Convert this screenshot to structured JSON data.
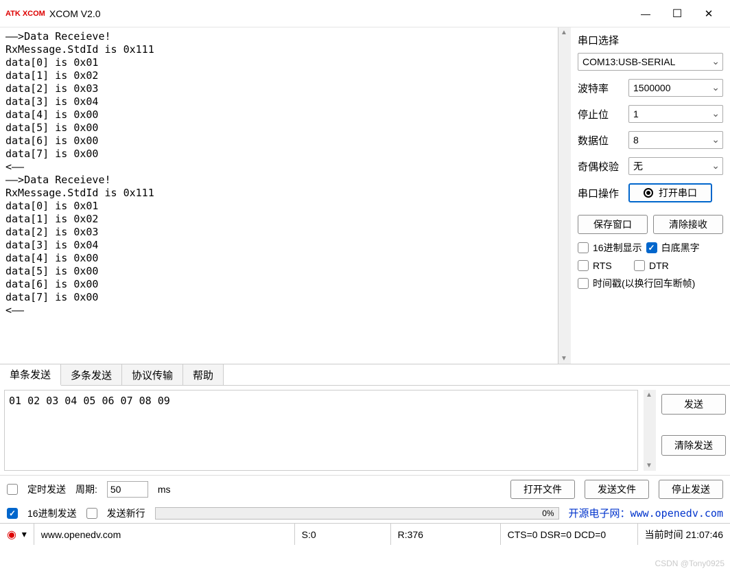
{
  "title": "XCOM V2.0",
  "logo_text": "ATK\nXCOM",
  "rx_log": "——>Data Receieve!\nRxMessage.StdId is 0x111\ndata[0] is 0x01\ndata[1] is 0x02\ndata[2] is 0x03\ndata[3] is 0x04\ndata[4] is 0x00\ndata[5] is 0x00\ndata[6] is 0x00\ndata[7] is 0x00\n<——\n——>Data Receieve!\nRxMessage.StdId is 0x111\ndata[0] is 0x01\ndata[1] is 0x02\ndata[2] is 0x03\ndata[3] is 0x04\ndata[4] is 0x00\ndata[5] is 0x00\ndata[6] is 0x00\ndata[7] is 0x00\n<——",
  "side": {
    "title": "串口选择",
    "port": "COM13:USB-SERIAL",
    "baud_label": "波特率",
    "baud": "1500000",
    "stop_label": "停止位",
    "stop": "1",
    "databits_label": "数据位",
    "databits": "8",
    "parity_label": "奇偶校验",
    "parity": "无",
    "op_label": "串口操作",
    "open_btn": "打开串口",
    "save_btn": "保存窗口",
    "clear_btn": "清除接收",
    "hex_disp": "16进制显示",
    "white_bg": "白底黑字",
    "rts": "RTS",
    "dtr": "DTR",
    "timestamp": "时间戳(以换行回车断帧)"
  },
  "tabs": {
    "t1": "单条发送",
    "t2": "多条发送",
    "t3": "协议传输",
    "t4": "帮助"
  },
  "send_text": "01 02 03 04 05 06 07 08 09",
  "send_btn": "发送",
  "clear_send_btn": "清除发送",
  "opts": {
    "timed": "定时发送",
    "period_label": "周期:",
    "period": "50",
    "ms": "ms",
    "open_file": "打开文件",
    "send_file": "发送文件",
    "stop_send": "停止发送",
    "hex_send": "16进制发送",
    "send_newline": "发送新行",
    "progress": "0%",
    "link_text": "开源电子网：www.openedv.com"
  },
  "status": {
    "url": "www.openedv.com",
    "s": "S:0",
    "r": "R:376",
    "signals": "CTS=0 DSR=0 DCD=0",
    "time_label": "当前时间 21:07:46"
  },
  "watermark": "CSDN @Tony0925"
}
